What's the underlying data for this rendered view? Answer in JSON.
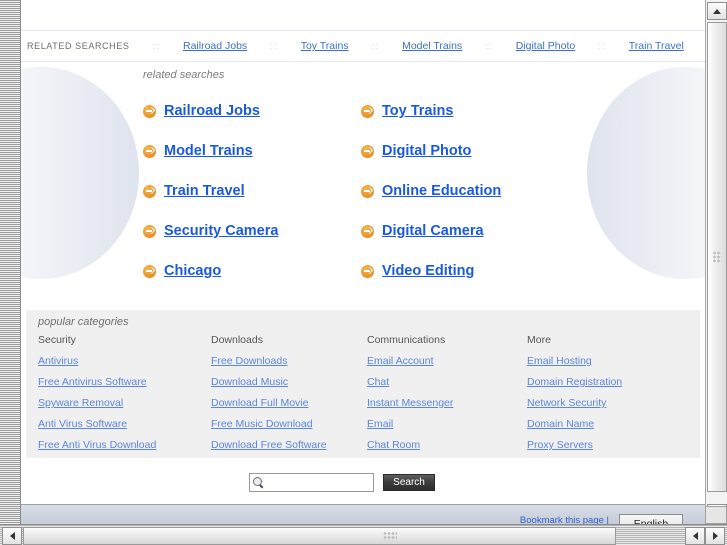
{
  "related_strip": {
    "label": "RELATED SEARCHES",
    "separator": "::",
    "links": [
      "Railroad Jobs",
      "Toy Trains",
      "Model Trains",
      "Digital Photo",
      "Train Travel"
    ]
  },
  "main": {
    "heading": "related searches",
    "links": [
      "Railroad Jobs",
      "Toy Trains",
      "Model Trains",
      "Digital Photo",
      "Train Travel",
      "Online Education",
      "Security Camera",
      "Digital Camera",
      "Chicago",
      "Video Editing"
    ],
    "arrow_icon": "arrow-circle-right-icon"
  },
  "categories": {
    "heading": "popular categories",
    "columns": [
      {
        "title": "Security",
        "links": [
          "Antivirus",
          "Free Antivirus Software",
          "Spyware Removal",
          "Anti Virus Software",
          "Free Anti Virus Download"
        ]
      },
      {
        "title": "Downloads",
        "links": [
          "Free Downloads",
          "Download Music",
          "Download Full Movie",
          "Free Music Download",
          "Download Free Software"
        ]
      },
      {
        "title": "Communications",
        "links": [
          "Email Account",
          "Chat",
          "Instant Messenger",
          "Email",
          "Chat Room"
        ]
      },
      {
        "title": "More",
        "links": [
          "Email Hosting",
          "Domain Registration",
          "Network Security",
          "Domain Name",
          "Proxy Servers"
        ]
      }
    ]
  },
  "search": {
    "value": "",
    "placeholder": "",
    "button_label": "Search",
    "icon": "magnifier-icon"
  },
  "footer": {
    "bookmark_label": "Bookmark this page |",
    "language": "English"
  },
  "colors": {
    "main_link": "#1a5ae0",
    "small_link": "#5b86df",
    "arrow_orange": "#e8861a",
    "panel_bg": "#f0f0f0",
    "footer_bg": "#c6ccd8"
  },
  "scrollbars": {
    "up_arrow": "triangle-up-icon",
    "down_arrow": "triangle-down-icon",
    "left_arrow": "triangle-left-icon",
    "right_arrow": "triangle-right-icon"
  }
}
